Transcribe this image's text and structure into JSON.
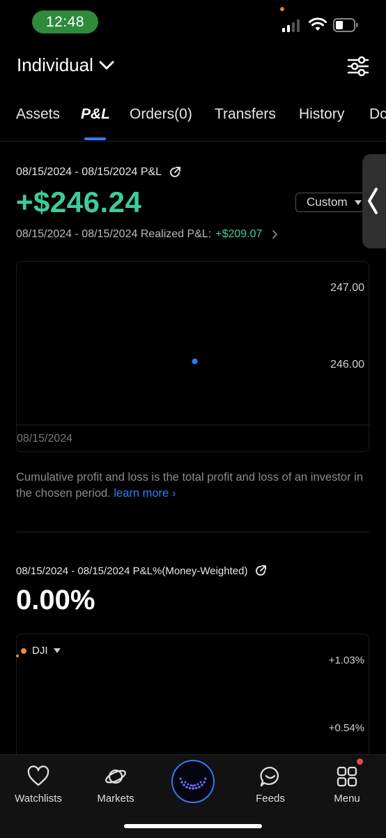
{
  "status_bar": {
    "time": "12:48"
  },
  "header": {
    "account_label": "Individual"
  },
  "tabs": [
    {
      "label": "Assets"
    },
    {
      "label": "P&L",
      "active": true
    },
    {
      "label": "Orders(0)"
    },
    {
      "label": "Transfers"
    },
    {
      "label": "History"
    },
    {
      "label": "Dc"
    }
  ],
  "pnl": {
    "range_title": "08/15/2024 - 08/15/2024 P&L",
    "value": "+$246.24",
    "period_selector": "Custom",
    "realized_label": "08/15/2024 - 08/15/2024 Realized P&L:",
    "realized_value": "+$209.07"
  },
  "chart_data": {
    "type": "scatter",
    "x": [
      "08/15/2024"
    ],
    "y": [
      246.24
    ],
    "ylim": [
      245.5,
      247.4
    ],
    "y_ticks": [
      "247.00",
      "246.00"
    ],
    "x_ticks": [
      "08/15/2024"
    ],
    "series_color": "#2f7cf6"
  },
  "description": {
    "text": "Cumulative profit and loss is the total profit and loss of an investor in the chosen period.",
    "link": "learn more"
  },
  "pnl_pct": {
    "range_title": "08/15/2024 - 08/15/2024 P&L%(Money-Weighted)",
    "value": "0.00%",
    "benchmark": "DJI",
    "y_ticks": [
      "+1.03%",
      "+0.54%"
    ]
  },
  "bottom_nav": [
    {
      "label": "Watchlists",
      "icon": "heart-icon"
    },
    {
      "label": "Markets",
      "icon": "planet-icon"
    },
    {
      "label": "",
      "icon": "moomoo-center-icon"
    },
    {
      "label": "Feeds",
      "icon": "chat-smile-icon"
    },
    {
      "label": "Menu",
      "icon": "grid-icon"
    }
  ],
  "colors": {
    "accent": "#2f7cf6",
    "gain": "#3ecc9d",
    "benchmark": "#ee8c3a",
    "notification": "#e5484d"
  }
}
